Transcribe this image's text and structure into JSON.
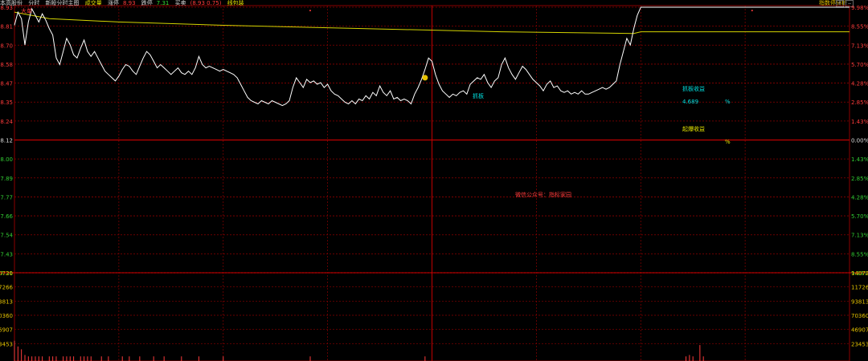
{
  "header": {
    "stock_name": "本高股份",
    "mode_tab": "分时",
    "indicator_name": "新股分时主图",
    "gap_label": "成交量",
    "rise_stop_label": "涨停",
    "rise_stop_value": "8.93",
    "fall_stop_label": "跌停",
    "fall_stop_value": "7.31",
    "cursor_label": "买卖",
    "cursor_value": "(8.93 0.75)",
    "extra_label": "线包装",
    "right_tab": "指数停分析",
    "win_buttons": [
      "F",
      "−"
    ]
  },
  "annotations": {
    "top_left_tag": "大单",
    "dip_tag": "抓板",
    "gain_title": "抓板收益",
    "gain_value": "4.689",
    "gain_pct": "%",
    "boom_title": "起爆收益",
    "boom_pct": "%",
    "watermark": "微信公众号：指标家园"
  },
  "colors": {
    "background": "#000000",
    "grid": "#8b0000",
    "price_line": "#ffffff",
    "avg_line": "#d4d400",
    "left_axis_up": "#ff3b3b",
    "left_axis_down": "#33cc33",
    "right_axis_up": "#ff3b3b",
    "right_axis_down": "#33cc33",
    "volume_bar": "#ff3b3b"
  },
  "chart_data": [
    {
      "type": "line",
      "name": "price-panel",
      "ylim": [
        7.31,
        8.93
      ],
      "base_price": 8.12,
      "y_ticks_left": [
        "8.93",
        "8.81",
        "8.70",
        "8.58",
        "8.47",
        "8.35",
        "8.24",
        "8.12",
        "8.00",
        "7.89",
        "7.77",
        "7.66",
        "7.54",
        "7.43",
        "7.31"
      ],
      "y_ticks_right": [
        "9.98%",
        "8.55%",
        "7.13%",
        "5.70%",
        "4.28%",
        "2.85%",
        "1.43%",
        "0.00%",
        "1.43%",
        "2.85%",
        "4.28%",
        "5.70%",
        "7.13%",
        "8.55%",
        "9.98%"
      ],
      "x_range": [
        0,
        240
      ],
      "series": [
        {
          "values": [
            [
              0,
              8.82
            ],
            [
              2,
              8.9
            ],
            [
              4,
              8.7
            ],
            [
              6,
              8.86
            ],
            [
              8,
              8.91
            ],
            [
              10,
              8.83
            ],
            [
              12,
              8.87
            ],
            [
              14,
              8.82
            ],
            [
              16,
              8.78
            ],
            [
              18,
              8.6
            ],
            [
              20,
              8.57
            ],
            [
              22,
              8.72
            ],
            [
              24,
              8.67
            ],
            [
              26,
              8.63
            ],
            [
              28,
              8.72
            ],
            [
              30,
              8.64
            ],
            [
              32,
              8.61
            ],
            [
              34,
              8.63
            ],
            [
              36,
              8.58
            ],
            [
              38,
              8.52
            ],
            [
              40,
              8.51
            ],
            [
              42,
              8.47
            ],
            [
              44,
              8.5
            ],
            [
              46,
              8.52
            ],
            [
              48,
              8.56
            ],
            [
              50,
              8.53
            ],
            [
              52,
              8.57
            ],
            [
              54,
              8.52
            ],
            [
              56,
              8.58
            ],
            [
              58,
              8.52
            ],
            [
              60,
              8.64
            ],
            [
              62,
              8.58
            ],
            [
              64,
              8.56
            ],
            [
              66,
              8.58
            ],
            [
              68,
              8.52
            ],
            [
              70,
              8.53
            ],
            [
              72,
              8.5
            ],
            [
              74,
              8.55
            ],
            [
              76,
              8.53
            ],
            [
              78,
              8.54
            ],
            [
              80,
              8.51
            ],
            [
              82,
              8.5
            ],
            [
              84,
              8.53
            ],
            [
              86,
              8.5
            ],
            [
              88,
              8.51
            ],
            [
              90,
              8.62
            ],
            [
              92,
              8.58
            ],
            [
              94,
              8.55
            ],
            [
              96,
              8.56
            ],
            [
              98,
              8.55
            ],
            [
              100,
              8.55
            ],
            [
              102,
              8.53
            ],
            [
              104,
              8.54
            ],
            [
              106,
              8.52
            ],
            [
              108,
              8.53
            ],
            [
              110,
              8.52
            ],
            [
              112,
              8.52
            ],
            [
              114,
              8.5
            ],
            [
              116,
              8.48
            ],
            [
              118,
              8.46
            ],
            [
              120,
              8.42
            ],
            [
              122,
              8.38
            ],
            [
              124,
              8.36
            ],
            [
              126,
              8.37
            ],
            [
              128,
              8.35
            ],
            [
              130,
              8.34
            ],
            [
              132,
              8.35
            ],
            [
              134,
              8.37
            ],
            [
              136,
              8.35
            ],
            [
              138,
              8.38
            ],
            [
              140,
              8.36
            ],
            [
              142,
              8.34
            ],
            [
              144,
              8.33
            ],
            [
              146,
              8.34
            ],
            [
              148,
              8.37
            ],
            [
              150,
              8.5
            ],
            [
              152,
              8.46
            ],
            [
              154,
              8.43
            ],
            [
              156,
              8.48
            ],
            [
              158,
              8.46
            ],
            [
              160,
              8.48
            ],
            [
              162,
              8.46
            ],
            [
              164,
              8.47
            ],
            [
              166,
              8.43
            ],
            [
              168,
              8.46
            ],
            [
              170,
              8.41
            ],
            [
              172,
              8.42
            ],
            [
              174,
              8.4
            ],
            [
              176,
              8.38
            ],
            [
              178,
              8.36
            ],
            [
              180,
              8.35
            ],
            [
              182,
              8.34
            ],
            [
              184,
              8.36
            ],
            [
              186,
              8.34
            ],
            [
              188,
              8.37
            ],
            [
              190,
              8.35
            ],
            [
              192,
              8.38
            ],
            [
              194,
              8.36
            ],
            [
              196,
              8.4
            ],
            [
              198,
              8.38
            ],
            [
              200,
              8.42
            ],
            [
              202,
              8.38
            ],
            [
              204,
              8.46
            ],
            [
              206,
              8.4
            ],
            [
              208,
              8.41
            ],
            [
              210,
              8.38
            ],
            [
              212,
              8.42
            ],
            [
              214,
              8.48
            ],
            [
              216,
              8.4
            ],
            [
              218,
              8.38
            ],
            [
              220,
              8.37
            ],
            [
              222,
              8.36
            ],
            [
              224,
              8.35
            ],
            [
              226,
              8.37
            ],
            [
              228,
              8.34
            ],
            [
              230,
              8.43
            ],
            [
              232,
              8.5
            ],
            [
              234,
              8.55
            ],
            [
              236,
              8.63
            ],
            [
              238,
              8.6
            ],
            [
              240,
              8.55
            ]
          ],
          "note_only_partial": ""
        }
      ]
    },
    {
      "type": "bar",
      "name": "volume-panel",
      "ylim": [
        0,
        140720
      ],
      "y_ticks_left": [
        "140720",
        "117266",
        "93813",
        "70360",
        "46907",
        "23453"
      ],
      "y_ticks_right": [
        "140720",
        "117266",
        "93813",
        "70360",
        "46907",
        "23453"
      ],
      "values": []
    }
  ],
  "price_series_full": [
    [
      0,
      8.82
    ],
    [
      1,
      8.9
    ],
    [
      2,
      8.86
    ],
    [
      3,
      8.7
    ],
    [
      4,
      8.84
    ],
    [
      5,
      8.92
    ],
    [
      6,
      8.88
    ],
    [
      7,
      8.84
    ],
    [
      8,
      8.89
    ],
    [
      9,
      8.85
    ],
    [
      10,
      8.8
    ],
    [
      11,
      8.76
    ],
    [
      12,
      8.62
    ],
    [
      13,
      8.58
    ],
    [
      14,
      8.66
    ],
    [
      15,
      8.74
    ],
    [
      16,
      8.7
    ],
    [
      17,
      8.64
    ],
    [
      18,
      8.62
    ],
    [
      19,
      8.68
    ],
    [
      20,
      8.73
    ],
    [
      21,
      8.66
    ],
    [
      22,
      8.63
    ],
    [
      23,
      8.66
    ],
    [
      24,
      8.62
    ],
    [
      25,
      8.58
    ],
    [
      26,
      8.54
    ],
    [
      27,
      8.52
    ],
    [
      28,
      8.5
    ],
    [
      29,
      8.48
    ],
    [
      30,
      8.51
    ],
    [
      31,
      8.55
    ],
    [
      32,
      8.58
    ],
    [
      33,
      8.57
    ],
    [
      34,
      8.54
    ],
    [
      35,
      8.52
    ],
    [
      36,
      8.57
    ],
    [
      37,
      8.62
    ],
    [
      38,
      8.66
    ],
    [
      39,
      8.64
    ],
    [
      40,
      8.6
    ],
    [
      41,
      8.56
    ],
    [
      42,
      8.58
    ],
    [
      43,
      8.56
    ],
    [
      44,
      8.54
    ],
    [
      45,
      8.52
    ],
    [
      46,
      8.54
    ],
    [
      47,
      8.56
    ],
    [
      48,
      8.53
    ],
    [
      49,
      8.52
    ],
    [
      50,
      8.54
    ],
    [
      51,
      8.52
    ],
    [
      52,
      8.56
    ],
    [
      53,
      8.63
    ],
    [
      54,
      8.58
    ],
    [
      55,
      8.56
    ],
    [
      56,
      8.57
    ],
    [
      57,
      8.56
    ],
    [
      58,
      8.55
    ],
    [
      59,
      8.54
    ],
    [
      60,
      8.55
    ],
    [
      61,
      8.54
    ],
    [
      62,
      8.53
    ],
    [
      63,
      8.52
    ],
    [
      64,
      8.5
    ],
    [
      65,
      8.46
    ],
    [
      66,
      8.42
    ],
    [
      67,
      8.38
    ],
    [
      68,
      8.36
    ],
    [
      69,
      8.35
    ],
    [
      70,
      8.34
    ],
    [
      71,
      8.36
    ],
    [
      72,
      8.35
    ],
    [
      73,
      8.34
    ],
    [
      74,
      8.36
    ],
    [
      75,
      8.35
    ],
    [
      76,
      8.34
    ],
    [
      77,
      8.33
    ],
    [
      78,
      8.34
    ],
    [
      79,
      8.36
    ],
    [
      80,
      8.44
    ],
    [
      81,
      8.5
    ],
    [
      82,
      8.47
    ],
    [
      83,
      8.44
    ],
    [
      84,
      8.49
    ],
    [
      85,
      8.47
    ],
    [
      86,
      8.48
    ],
    [
      87,
      8.46
    ],
    [
      88,
      8.47
    ],
    [
      89,
      8.44
    ],
    [
      90,
      8.46
    ],
    [
      91,
      8.42
    ],
    [
      92,
      8.4
    ],
    [
      93,
      8.39
    ],
    [
      94,
      8.37
    ],
    [
      95,
      8.35
    ],
    [
      96,
      8.34
    ],
    [
      97,
      8.36
    ],
    [
      98,
      8.34
    ],
    [
      99,
      8.37
    ],
    [
      100,
      8.36
    ],
    [
      101,
      8.39
    ],
    [
      102,
      8.37
    ],
    [
      103,
      8.41
    ],
    [
      104,
      8.39
    ],
    [
      105,
      8.45
    ],
    [
      106,
      8.41
    ],
    [
      107,
      8.39
    ],
    [
      108,
      8.42
    ],
    [
      109,
      8.37
    ],
    [
      110,
      8.38
    ],
    [
      111,
      8.36
    ],
    [
      112,
      8.37
    ],
    [
      113,
      8.36
    ],
    [
      114,
      8.34
    ],
    [
      115,
      8.4
    ],
    [
      116,
      8.44
    ],
    [
      117,
      8.49
    ],
    [
      118,
      8.55
    ],
    [
      119,
      8.62
    ],
    [
      120,
      8.6
    ],
    [
      121,
      8.52
    ],
    [
      122,
      8.46
    ],
    [
      123,
      8.42
    ],
    [
      124,
      8.4
    ],
    [
      125,
      8.38
    ],
    [
      126,
      8.4
    ],
    [
      127,
      8.39
    ],
    [
      128,
      8.41
    ],
    [
      129,
      8.42
    ],
    [
      130,
      8.4
    ],
    [
      131,
      8.46
    ],
    [
      132,
      8.48
    ],
    [
      133,
      8.5
    ],
    [
      134,
      8.49
    ],
    [
      135,
      8.52
    ],
    [
      136,
      8.47
    ],
    [
      137,
      8.44
    ],
    [
      138,
      8.48
    ],
    [
      139,
      8.5
    ],
    [
      140,
      8.58
    ],
    [
      141,
      8.62
    ],
    [
      142,
      8.56
    ],
    [
      143,
      8.52
    ],
    [
      144,
      8.49
    ],
    [
      145,
      8.53
    ],
    [
      146,
      8.57
    ],
    [
      147,
      8.55
    ],
    [
      148,
      8.52
    ],
    [
      149,
      8.49
    ],
    [
      150,
      8.47
    ],
    [
      151,
      8.45
    ],
    [
      152,
      8.42
    ],
    [
      153,
      8.46
    ],
    [
      154,
      8.48
    ],
    [
      155,
      8.44
    ],
    [
      156,
      8.45
    ],
    [
      157,
      8.42
    ],
    [
      158,
      8.41
    ],
    [
      159,
      8.42
    ],
    [
      160,
      8.4
    ],
    [
      161,
      8.41
    ],
    [
      162,
      8.4
    ],
    [
      163,
      8.42
    ],
    [
      164,
      8.4
    ],
    [
      165,
      8.4
    ],
    [
      166,
      8.41
    ],
    [
      167,
      8.42
    ],
    [
      168,
      8.43
    ],
    [
      169,
      8.44
    ],
    [
      170,
      8.43
    ],
    [
      171,
      8.44
    ],
    [
      172,
      8.46
    ],
    [
      173,
      8.48
    ],
    [
      174,
      8.58
    ],
    [
      175,
      8.66
    ],
    [
      176,
      8.74
    ],
    [
      177,
      8.7
    ],
    [
      178,
      8.8
    ],
    [
      179,
      8.88
    ],
    [
      180,
      8.93
    ],
    [
      240,
      8.93
    ]
  ],
  "avg_series": [
    [
      0,
      8.9
    ],
    [
      10,
      8.86
    ],
    [
      30,
      8.84
    ],
    [
      60,
      8.82
    ],
    [
      100,
      8.8
    ],
    [
      140,
      8.78
    ],
    [
      178,
      8.77
    ],
    [
      180,
      8.78
    ],
    [
      240,
      8.78
    ]
  ],
  "volume_values": [
    12,
    8,
    6,
    2,
    1,
    1,
    1,
    1,
    1,
    0,
    1,
    1,
    1,
    0,
    1,
    1,
    1,
    1,
    0,
    1,
    1,
    1,
    1,
    0,
    0,
    1,
    0,
    1,
    0,
    0,
    0,
    1,
    0,
    1,
    0,
    0,
    1,
    0,
    0,
    0,
    1,
    0,
    0,
    1,
    0,
    0,
    0,
    0,
    1,
    0,
    0,
    0,
    0,
    1,
    0,
    0,
    0,
    0,
    0,
    0,
    1,
    0,
    0,
    0,
    0,
    0,
    0,
    0,
    0,
    0,
    0,
    0,
    0,
    0,
    0,
    0,
    0,
    0,
    0,
    0,
    0,
    0,
    0,
    0,
    0,
    1,
    0,
    0,
    0,
    0,
    0,
    0,
    0,
    0,
    0,
    0,
    0,
    0,
    0,
    0,
    0,
    0,
    0,
    0,
    0,
    0,
    0,
    0,
    0,
    0,
    0,
    0,
    0,
    0,
    0,
    0,
    0,
    0,
    1,
    0,
    0,
    0,
    0,
    0,
    0,
    0,
    0,
    0,
    0,
    0,
    0,
    0,
    0,
    0,
    0,
    0,
    0,
    0,
    0,
    0,
    0,
    0,
    0,
    0,
    0,
    0,
    0,
    0,
    0,
    0,
    0,
    0,
    0,
    0,
    0,
    0,
    0,
    0,
    0,
    0,
    0,
    0,
    0,
    0,
    0,
    0,
    0,
    0,
    0,
    0,
    0,
    0,
    0,
    0,
    0,
    0,
    0,
    0,
    0,
    0,
    0,
    0,
    0,
    0,
    0,
    0,
    0,
    0,
    0,
    0,
    0,
    0,
    0,
    1,
    2,
    1,
    0,
    9,
    1,
    0,
    0,
    0,
    0,
    0,
    0,
    0,
    0,
    0,
    0,
    0,
    0,
    0,
    0,
    0,
    0,
    0,
    0,
    0,
    0,
    0,
    0,
    0,
    0,
    0,
    0,
    0,
    0,
    0,
    0,
    0,
    0,
    0,
    0,
    0,
    0,
    0,
    0,
    0,
    0,
    0
  ]
}
